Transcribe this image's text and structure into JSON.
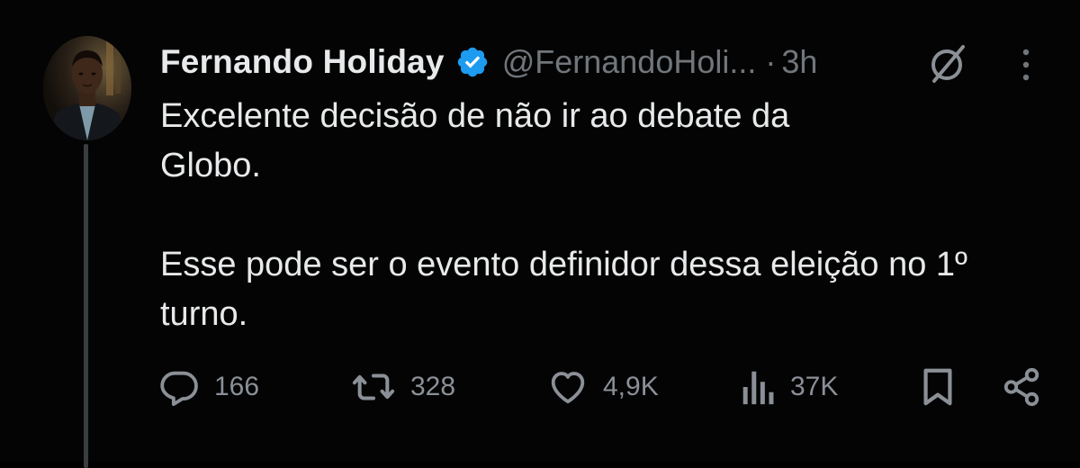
{
  "tweet": {
    "author": {
      "name": "Fernando Holiday",
      "handle": "@FernandoHoli...",
      "verified_color": "#1d9bf0"
    },
    "separator": "·",
    "time": "3h",
    "text_lines": {
      "p1_line1": "Excelente decisão de não ir ao debate da",
      "p1_line2": "Globo.",
      "p2_line1": "Esse pode ser o evento definidor dessa eleição no 1º",
      "p2_line2": "turno."
    },
    "icons": {
      "grok": "grok-icon",
      "more": "more-options-icon"
    },
    "actions": {
      "replies": "166",
      "retweets": "328",
      "likes": "4,9K",
      "views": "37K"
    }
  },
  "colors": {
    "background": "#040404",
    "text": "#e7e9ea",
    "secondary": "#71767b",
    "thread_line": "#3a3d40",
    "accent": "#1d9bf0"
  }
}
